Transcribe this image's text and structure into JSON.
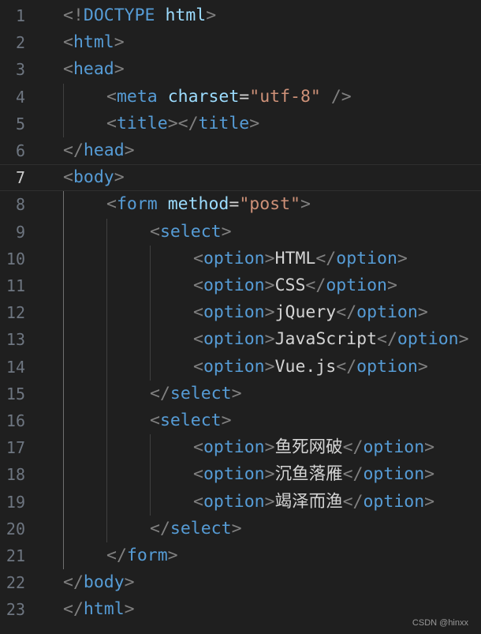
{
  "editor": {
    "watermark": "CSDN @hinxx",
    "current_line": 7,
    "lines": [
      {
        "n": "1",
        "indent": 0,
        "tokens": [
          [
            "p",
            "<!"
          ],
          [
            "t",
            "DOCTYPE"
          ],
          [
            "x",
            " "
          ],
          [
            "a",
            "html"
          ],
          [
            "p",
            ">"
          ]
        ]
      },
      {
        "n": "2",
        "indent": 0,
        "tokens": [
          [
            "p",
            "<"
          ],
          [
            "t",
            "html"
          ],
          [
            "p",
            ">"
          ]
        ]
      },
      {
        "n": "3",
        "indent": 0,
        "tokens": [
          [
            "p",
            "<"
          ],
          [
            "t",
            "head"
          ],
          [
            "p",
            ">"
          ]
        ]
      },
      {
        "n": "4",
        "indent": 1,
        "tokens": [
          [
            "p",
            "<"
          ],
          [
            "t",
            "meta"
          ],
          [
            "x",
            " "
          ],
          [
            "a",
            "charset"
          ],
          [
            "e",
            "="
          ],
          [
            "s",
            "\"utf-8\""
          ],
          [
            "x",
            " "
          ],
          [
            "p",
            "/>"
          ]
        ]
      },
      {
        "n": "5",
        "indent": 1,
        "tokens": [
          [
            "p",
            "<"
          ],
          [
            "t",
            "title"
          ],
          [
            "p",
            "></"
          ],
          [
            "t",
            "title"
          ],
          [
            "p",
            ">"
          ]
        ]
      },
      {
        "n": "6",
        "indent": 0,
        "tokens": [
          [
            "p",
            "</"
          ],
          [
            "t",
            "head"
          ],
          [
            "p",
            ">"
          ]
        ]
      },
      {
        "n": "7",
        "indent": 0,
        "tokens": [
          [
            "p",
            "<"
          ],
          [
            "t",
            "body"
          ],
          [
            "p",
            ">"
          ]
        ]
      },
      {
        "n": "8",
        "indent": 1,
        "tokens": [
          [
            "p",
            "<"
          ],
          [
            "t",
            "form"
          ],
          [
            "x",
            " "
          ],
          [
            "a",
            "method"
          ],
          [
            "e",
            "="
          ],
          [
            "s",
            "\"post\""
          ],
          [
            "p",
            ">"
          ]
        ]
      },
      {
        "n": "9",
        "indent": 2,
        "tokens": [
          [
            "p",
            "<"
          ],
          [
            "t",
            "select"
          ],
          [
            "p",
            ">"
          ]
        ]
      },
      {
        "n": "10",
        "indent": 3,
        "tokens": [
          [
            "p",
            "<"
          ],
          [
            "t",
            "option"
          ],
          [
            "p",
            ">"
          ],
          [
            "x",
            "HTML"
          ],
          [
            "p",
            "</"
          ],
          [
            "t",
            "option"
          ],
          [
            "p",
            ">"
          ]
        ]
      },
      {
        "n": "11",
        "indent": 3,
        "tokens": [
          [
            "p",
            "<"
          ],
          [
            "t",
            "option"
          ],
          [
            "p",
            ">"
          ],
          [
            "x",
            "CSS"
          ],
          [
            "p",
            "</"
          ],
          [
            "t",
            "option"
          ],
          [
            "p",
            ">"
          ]
        ]
      },
      {
        "n": "12",
        "indent": 3,
        "tokens": [
          [
            "p",
            "<"
          ],
          [
            "t",
            "option"
          ],
          [
            "p",
            ">"
          ],
          [
            "x",
            "jQuery"
          ],
          [
            "p",
            "</"
          ],
          [
            "t",
            "option"
          ],
          [
            "p",
            ">"
          ]
        ]
      },
      {
        "n": "13",
        "indent": 3,
        "tokens": [
          [
            "p",
            "<"
          ],
          [
            "t",
            "option"
          ],
          [
            "p",
            ">"
          ],
          [
            "x",
            "JavaScript"
          ],
          [
            "p",
            "</"
          ],
          [
            "t",
            "option"
          ],
          [
            "p",
            ">"
          ]
        ]
      },
      {
        "n": "14",
        "indent": 3,
        "tokens": [
          [
            "p",
            "<"
          ],
          [
            "t",
            "option"
          ],
          [
            "p",
            ">"
          ],
          [
            "x",
            "Vue.js"
          ],
          [
            "p",
            "</"
          ],
          [
            "t",
            "option"
          ],
          [
            "p",
            ">"
          ]
        ]
      },
      {
        "n": "15",
        "indent": 2,
        "tokens": [
          [
            "p",
            "</"
          ],
          [
            "t",
            "select"
          ],
          [
            "p",
            ">"
          ]
        ]
      },
      {
        "n": "16",
        "indent": 2,
        "tokens": [
          [
            "p",
            "<"
          ],
          [
            "t",
            "select"
          ],
          [
            "p",
            ">"
          ]
        ]
      },
      {
        "n": "17",
        "indent": 3,
        "tokens": [
          [
            "p",
            "<"
          ],
          [
            "t",
            "option"
          ],
          [
            "p",
            ">"
          ],
          [
            "c",
            "鱼死网破"
          ],
          [
            "p",
            "</"
          ],
          [
            "t",
            "option"
          ],
          [
            "p",
            ">"
          ]
        ]
      },
      {
        "n": "18",
        "indent": 3,
        "tokens": [
          [
            "p",
            "<"
          ],
          [
            "t",
            "option"
          ],
          [
            "p",
            ">"
          ],
          [
            "c",
            "沉鱼落雁"
          ],
          [
            "p",
            "</"
          ],
          [
            "t",
            "option"
          ],
          [
            "p",
            ">"
          ]
        ]
      },
      {
        "n": "19",
        "indent": 3,
        "tokens": [
          [
            "p",
            "<"
          ],
          [
            "t",
            "option"
          ],
          [
            "p",
            ">"
          ],
          [
            "c",
            "竭泽而渔"
          ],
          [
            "p",
            "</"
          ],
          [
            "t",
            "option"
          ],
          [
            "p",
            ">"
          ]
        ]
      },
      {
        "n": "20",
        "indent": 2,
        "tokens": [
          [
            "p",
            "</"
          ],
          [
            "t",
            "select"
          ],
          [
            "p",
            ">"
          ]
        ]
      },
      {
        "n": "21",
        "indent": 1,
        "tokens": [
          [
            "p",
            "</"
          ],
          [
            "t",
            "form"
          ],
          [
            "p",
            ">"
          ]
        ]
      },
      {
        "n": "22",
        "indent": 0,
        "tokens": [
          [
            "p",
            "</"
          ],
          [
            "t",
            "body"
          ],
          [
            "p",
            ">"
          ]
        ]
      },
      {
        "n": "23",
        "indent": 0,
        "tokens": [
          [
            "p",
            "</"
          ],
          [
            "t",
            "html"
          ],
          [
            "p",
            ">"
          ]
        ]
      }
    ]
  }
}
